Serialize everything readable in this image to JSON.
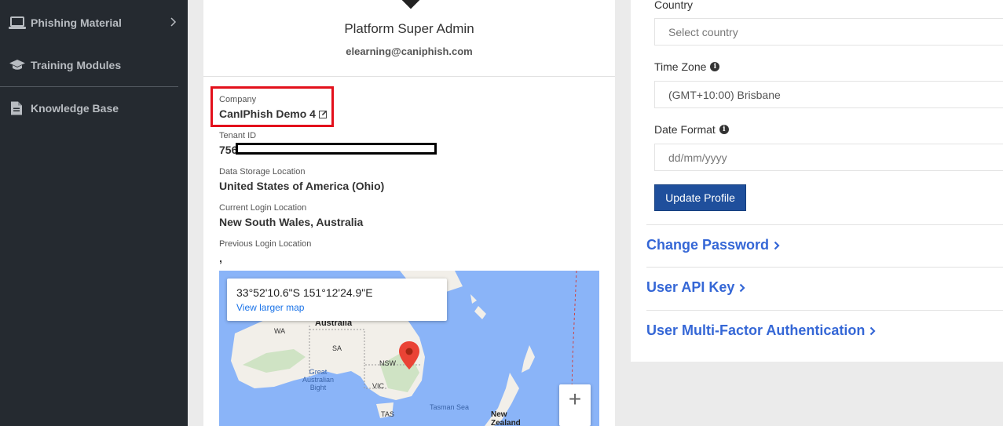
{
  "sidebar": {
    "items": [
      {
        "label": "Phishing Material",
        "icon": "laptop-icon",
        "has_chevron": true
      },
      {
        "label": "Training Modules",
        "icon": "graduation-cap-icon",
        "has_chevron": false
      },
      {
        "label": "Knowledge Base",
        "icon": "document-icon",
        "has_chevron": false
      }
    ]
  },
  "profile": {
    "title": "Platform Super Admin",
    "email": "elearning@caniphish.com",
    "company_label": "Company",
    "company_value": "CanIPhish Demo 4",
    "tenant_label": "Tenant ID",
    "tenant_value": "756",
    "storage_label": "Data Storage Location",
    "storage_value": "United States of America (Ohio)",
    "current_login_label": "Current Login Location",
    "current_login_value": "New South Wales, Australia",
    "previous_login_label": "Previous Login Location",
    "previous_login_value": ","
  },
  "map": {
    "coords": "33°52'10.6\"S 151°12'24.9\"E",
    "link": "View larger map",
    "labels": {
      "australia": "Australia",
      "wa": "WA",
      "sa": "SA",
      "nsw": "NSW",
      "vic": "VIC",
      "tas": "TAS",
      "bight": "Great\nAustralian\nBight",
      "tasman": "Tasman Sea",
      "nz": "New\nZealand"
    },
    "zoom_in": "+"
  },
  "settings": {
    "country_label": "Country",
    "country_value": "Select country",
    "timezone_label": "Time Zone",
    "timezone_value": "(GMT+10:00) Brisbane",
    "dateformat_label": "Date Format",
    "dateformat_placeholder": "dd/mm/yyyy",
    "update_button": "Update Profile"
  },
  "sections": {
    "change_password": "Change Password",
    "api_key": "User API Key",
    "mfa": "User Multi-Factor Authentication"
  },
  "colors": {
    "sidebar_bg": "#252a30",
    "accent_blue": "#3567d6",
    "button_blue": "#1f4f9c",
    "highlight_red": "#e3101b",
    "map_water": "#8ab4f8"
  }
}
